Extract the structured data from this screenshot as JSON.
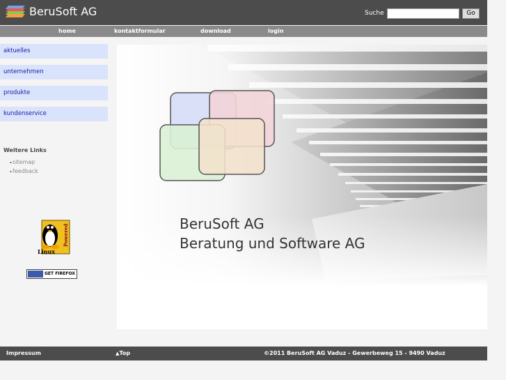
{
  "header": {
    "brand": "BeruSoft AG",
    "search_label": "Suche",
    "search_value": "",
    "go_label": "Go"
  },
  "nav": [
    "home",
    "kontaktformular",
    "download",
    "login"
  ],
  "sidebar": {
    "items": [
      "aktuelles",
      "unternehmen",
      "produkte",
      "kundenservice"
    ],
    "links_heading": "Weitere Links",
    "links": [
      "sitemap",
      "feedback"
    ],
    "badges": {
      "linux": "Linux",
      "powered": "Powered",
      "firefox": "GET FIREFOX"
    }
  },
  "hero": {
    "title": "BeruSoft AG",
    "subtitle": "Beratung und Software AG"
  },
  "footer": {
    "impressum": "Impressum",
    "top": "Top",
    "copyright": "©2011 BeruSoft AG Vaduz - Gewerbeweg 15 - 9490 Vaduz"
  },
  "colors": {
    "bar": "#4c4c4c",
    "nav": "#8a8a8a",
    "sidebar_bg": "#d9e3fb",
    "sidebar_text": "#1a1aa6"
  }
}
